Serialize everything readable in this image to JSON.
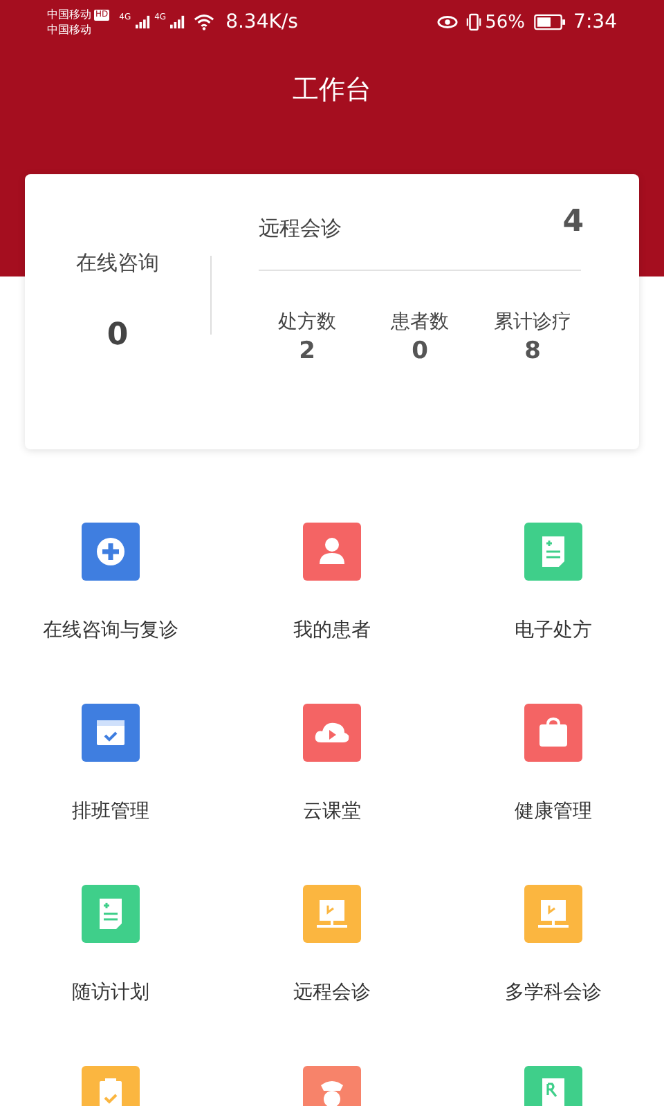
{
  "status_bar": {
    "carrier_1": "中国移动",
    "hd_badge": "HD",
    "carrier_2": "中国移动",
    "network_1": "4G",
    "network_2": "4G",
    "speed": "8.34K/s",
    "battery": "56%",
    "time": "7:34"
  },
  "header": {
    "title": "工作台"
  },
  "summary": {
    "online": {
      "label": "在线咨询",
      "value": "0"
    },
    "remote": {
      "label": "远程会诊",
      "value": "4"
    },
    "stats": [
      {
        "label": "处方数",
        "value": "2"
      },
      {
        "label": "患者数",
        "value": "0"
      },
      {
        "label": "累计诊疗",
        "value": "8"
      }
    ]
  },
  "menu": [
    {
      "label": "在线咨询与复诊",
      "kind": "plus",
      "color": "#3f7ee0"
    },
    {
      "label": "我的患者",
      "kind": "person",
      "color": "#f46464"
    },
    {
      "label": "电子处方",
      "kind": "document",
      "color": "#3fcf8a"
    },
    {
      "label": "排班管理",
      "kind": "calendar",
      "color": "#3f7ee0"
    },
    {
      "label": "云课堂",
      "kind": "cloud",
      "color": "#f46464"
    },
    {
      "label": "健康管理",
      "kind": "bag",
      "color": "#f46464"
    },
    {
      "label": "随访计划",
      "kind": "document",
      "color": "#3fcf8a"
    },
    {
      "label": "远程会诊",
      "kind": "monitor",
      "color": "#fbb640"
    },
    {
      "label": "多学科会诊",
      "kind": "monitor",
      "color": "#fbb640"
    },
    {
      "kind": "clipboard",
      "color": "#fbb640"
    },
    {
      "kind": "nurse",
      "color": "#f7836a"
    },
    {
      "kind": "prescription",
      "color": "#3fcf8a"
    }
  ]
}
